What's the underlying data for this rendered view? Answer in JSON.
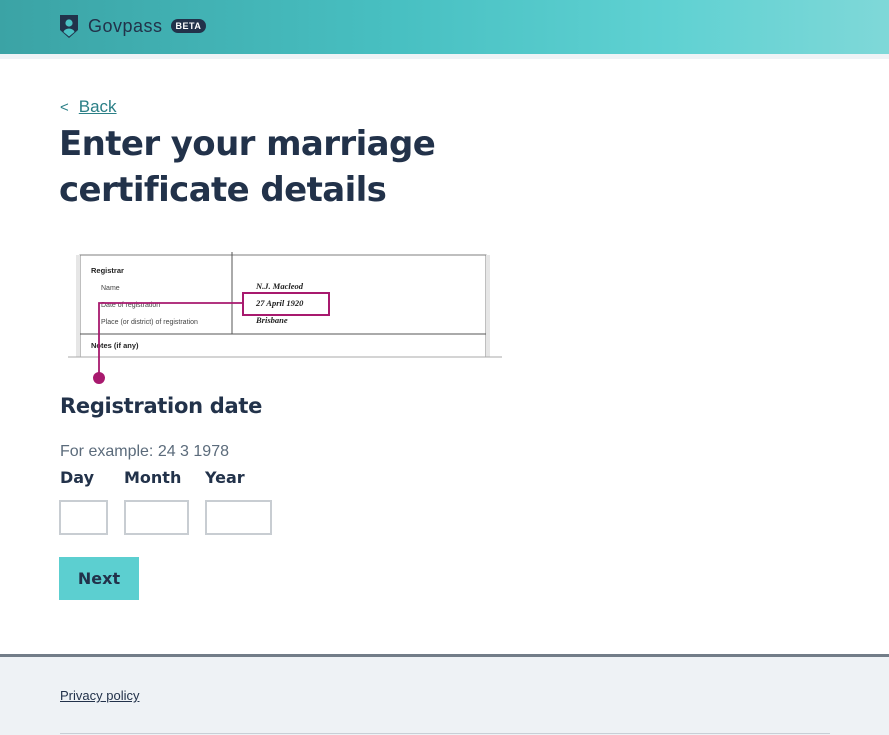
{
  "header": {
    "brand_name": "Govpass",
    "badge": "BETA",
    "logo_icon": "shield-icon",
    "colors": {
      "gradient_start": "#3ba3a5",
      "gradient_end": "#7fd8d8"
    }
  },
  "back_link": {
    "chevron": "<",
    "label": "Back"
  },
  "page_title": "Enter your marriage certificate details",
  "certificate_example": {
    "section_label": "Registrar",
    "rows": [
      {
        "label": "Name",
        "value": "N.J. Macleod"
      },
      {
        "label": "Date of registration",
        "value": "27 April 1920"
      },
      {
        "label": "Place (or district) of registration",
        "value": "Brisbane"
      }
    ],
    "notes_label": "Notes (if any)",
    "highlight_color": "#a8196e"
  },
  "registration_date": {
    "heading": "Registration date",
    "hint": "For example: 24 3 1978",
    "fields": [
      {
        "label": "Day",
        "value": ""
      },
      {
        "label": "Month",
        "value": ""
      },
      {
        "label": "Year",
        "value": ""
      }
    ]
  },
  "next_button": {
    "label": "Next",
    "color": "#5ccfd0"
  },
  "footer": {
    "privacy_link": "Privacy policy"
  }
}
